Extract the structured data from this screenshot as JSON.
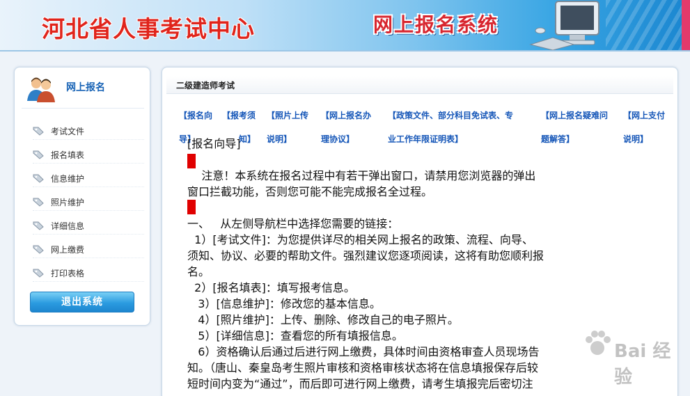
{
  "header": {
    "org_title": "河北省人事考试中心",
    "system_title": "网上报名系统"
  },
  "sidebar": {
    "heading": "网上报名",
    "items": [
      {
        "label": "考试文件"
      },
      {
        "label": "报名填表"
      },
      {
        "label": "信息维护"
      },
      {
        "label": "照片维护"
      },
      {
        "label": "详细信息"
      },
      {
        "label": "网上缴费"
      },
      {
        "label": "打印表格"
      }
    ],
    "logout_label": "退出系统"
  },
  "main": {
    "title": "二级建造师考试",
    "links": [
      {
        "line1": "【报名向",
        "line2": "导】"
      },
      {
        "line1": "【报考须",
        "line2": "知】"
      },
      {
        "line1": "【照片上传",
        "line2": "说明】"
      },
      {
        "line1": "【网上报名办",
        "line2": "理协议】"
      },
      {
        "line1": "【政策文件、部分科目免试表、专",
        "line2": "业工作年限证明表】"
      },
      {
        "line1": "【网上报名疑难问",
        "line2": "题解答】"
      },
      {
        "line1": "【网上支付",
        "line2": "说明】"
      }
    ],
    "content": {
      "heading": "[报名向导]",
      "notice": [
        "    注意！本系统在报名过程中有若干弹出窗口，请禁用您浏览器的弹出",
        "窗口拦截功能，否则您可能不能完成报名全过程。"
      ],
      "step_one": "一、   从左侧导航栏中选择您需要的链接：",
      "lines": [
        "  1）[考试文件]：为您提供详尽的相关网上报名的政策、流程、向导、",
        "须知、协议、必要的帮助文件。强烈建议您逐项阅读，这将有助您顺利报",
        "名。",
        "  2）[报名填表]：填写报考信息。",
        "   3）[信息维护]：修改您的基本信息。",
        "   4）[照片维护]：上传、删除、修改自己的电子照片。",
        "   5）[详细信息]：查看您的所有填报信息。",
        "   6）资格确认后通过后进行网上缴费，具体时间由资格审查人员现场告",
        "知。（唐山、秦皇岛考生照片审核和资格审核状态将在信息填报保存后较",
        "短时间内变为“通过”，而后即可进行网上缴费，请考生填报完后密切注"
      ]
    }
  },
  "watermark": {
    "text": "Bai 经验"
  },
  "colors": {
    "accent": "#1556b8",
    "brand_red": "#e0241b",
    "button": "#2b9be0"
  }
}
